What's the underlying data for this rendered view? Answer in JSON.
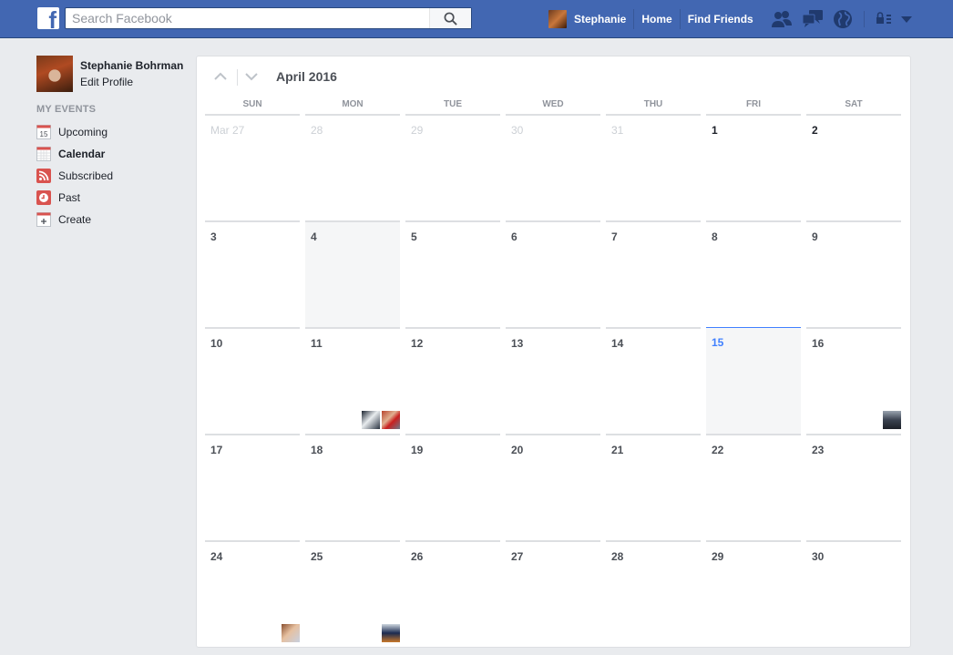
{
  "topbar": {
    "logo": "f",
    "search_placeholder": "Search Facebook",
    "search_value": "",
    "user_name": "Stephanie",
    "home_label": "Home",
    "find_friends_label": "Find Friends",
    "icons": [
      "friend-requests-icon",
      "messages-icon",
      "notifications-globe-icon",
      "privacy-shortcuts-icon",
      "account-menu-dropdown-icon"
    ]
  },
  "sidebar": {
    "profile_name": "Stephanie Bohrman",
    "edit_profile_label": "Edit Profile",
    "section_title": "MY EVENTS",
    "items": [
      {
        "label": "Upcoming",
        "icon": "calendar-day-icon",
        "icon_text": "15",
        "active": false
      },
      {
        "label": "Calendar",
        "icon": "calendar-grid-icon",
        "active": true
      },
      {
        "label": "Subscribed",
        "icon": "rss-icon",
        "active": false
      },
      {
        "label": "Past",
        "icon": "clock-icon",
        "active": false
      },
      {
        "label": "Create",
        "icon": "create-event-icon",
        "active": false
      }
    ]
  },
  "calendar": {
    "month_title": "April 2016",
    "weekdays": [
      "SUN",
      "MON",
      "TUE",
      "WED",
      "THU",
      "FRI",
      "SAT"
    ],
    "weeks": [
      [
        {
          "label": "Mar 27",
          "other": true
        },
        {
          "label": "28",
          "other": true
        },
        {
          "label": "29",
          "other": true
        },
        {
          "label": "30",
          "other": true
        },
        {
          "label": "31",
          "other": true
        },
        {
          "label": "1"
        },
        {
          "label": "2"
        }
      ],
      [
        {
          "label": "3"
        },
        {
          "label": "4",
          "shaded": true
        },
        {
          "label": "5"
        },
        {
          "label": "6"
        },
        {
          "label": "7"
        },
        {
          "label": "8"
        },
        {
          "label": "9"
        }
      ],
      [
        {
          "label": "10"
        },
        {
          "label": "11",
          "events": 2
        },
        {
          "label": "12"
        },
        {
          "label": "13"
        },
        {
          "label": "14"
        },
        {
          "label": "15",
          "today": true
        },
        {
          "label": "16",
          "events": 1
        }
      ],
      [
        {
          "label": "17"
        },
        {
          "label": "18"
        },
        {
          "label": "19"
        },
        {
          "label": "20"
        },
        {
          "label": "21"
        },
        {
          "label": "22"
        },
        {
          "label": "23"
        }
      ],
      [
        {
          "label": "24",
          "events": 1
        },
        {
          "label": "25",
          "events": 1
        },
        {
          "label": "26"
        },
        {
          "label": "27"
        },
        {
          "label": "28"
        },
        {
          "label": "29"
        },
        {
          "label": "30"
        }
      ]
    ]
  },
  "colors": {
    "brand": "#4267b2",
    "today": "#4080ff",
    "muted": "#90949c"
  }
}
